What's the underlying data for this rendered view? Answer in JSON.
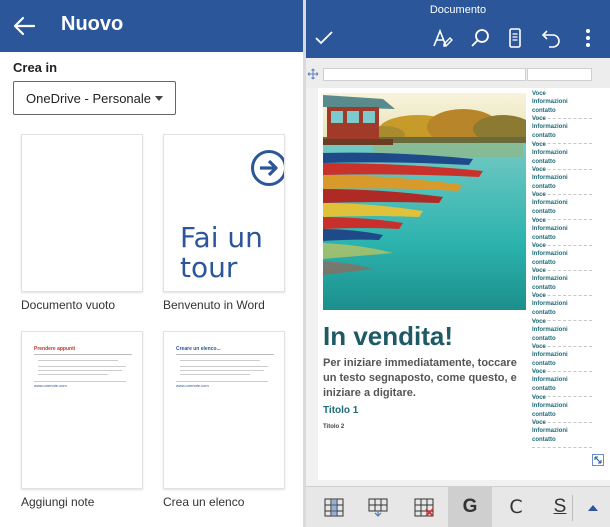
{
  "left_panel": {
    "header": {
      "title": "Nuovo",
      "back_icon": "arrow-left-icon",
      "bg": "#2b579a"
    },
    "location": {
      "label": "Crea in",
      "selected": "OneDrive - Personale"
    },
    "templates": [
      {
        "label": "Documento vuoto"
      },
      {
        "label": "Benvenuto in Word",
        "preview_text": "Fai un tour"
      },
      {
        "label": "Aggiungi note",
        "preview_title": "Prendere appunti",
        "preview_footer": "www.onenote.com"
      },
      {
        "label": "Crea un elenco",
        "preview_title": "Creare un elenco...",
        "preview_footer": "www.onenote.com"
      }
    ]
  },
  "right_panel": {
    "header": {
      "title": "Documento",
      "bg": "#2b579a"
    },
    "toolbar_icons": [
      "check-icon",
      "pen-format-icon",
      "search-icon",
      "mobile-view-icon",
      "undo-icon",
      "more-vert-icon"
    ],
    "document": {
      "headline": "In vendita!",
      "intro": "Per iniziare immediatamente, toccare un testo segnaposto, come questo, e iniziare a digitare.",
      "title1": "Titolo 1",
      "title2": "Titolo 2",
      "sidebar": [
        {
          "voce": "Voce",
          "info": "Informazioni contatto"
        },
        {
          "voce": "Voce",
          "info": "Informazioni contatto"
        },
        {
          "voce": "Voce",
          "info": "Informazioni contatto"
        },
        {
          "voce": "Voce",
          "info": "Informazioni contatto"
        },
        {
          "voce": "Voce",
          "info": "Informazioni contatto"
        },
        {
          "voce": "Voce",
          "info": "Informazioni contatto"
        },
        {
          "voce": "Voce",
          "info": "Informazioni contatto"
        },
        {
          "voce": "Voce",
          "info": "Informazioni contatto"
        },
        {
          "voce": "Voce",
          "info": "Informazioni contatto"
        },
        {
          "voce": "Voce",
          "info": "Informazioni contatto"
        },
        {
          "voce": "Voce",
          "info": "Informazioni contatto"
        },
        {
          "voce": "Voce",
          "info": "Informazioni contatto"
        },
        {
          "voce": "Voce",
          "info": "Informazioni contatto"
        },
        {
          "voce": "Voce",
          "info": "Informazioni contatto"
        }
      ]
    },
    "bottom_toolbar": {
      "icons": [
        "insert-column-icon",
        "insert-row-icon",
        "delete-cell-icon",
        "bold-button",
        "italic-button",
        "underline-button",
        "expand-up-icon"
      ],
      "bold_label": "G",
      "italic_label": "C",
      "underline_label": "S"
    }
  }
}
